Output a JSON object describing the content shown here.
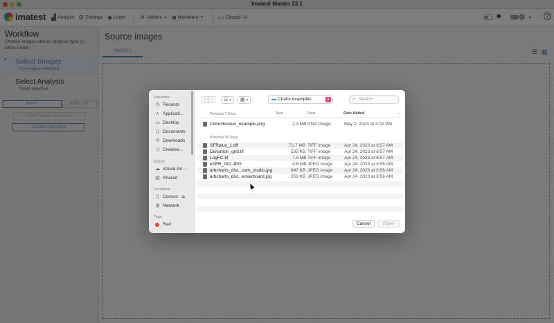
{
  "window": {
    "title": "Imatest Master 23.1"
  },
  "toolbar": {
    "logo": "imatest",
    "analyze": "Analyze",
    "settings": "Settings",
    "learn": "Learn",
    "utilities": "Utilities",
    "hardware": "Hardware",
    "classic_ui": "Classic UI"
  },
  "sidebar": {
    "title": "Workflow",
    "subtitle": "Choose images and an analysis type (in either order)",
    "step1": {
      "name": "Select Images",
      "sub": "No images selected"
    },
    "step2": {
      "name": "Select Analysis",
      "sub": "None selected"
    },
    "next": "NEXT",
    "analyze": "ANALYZE",
    "start_new": "START NEW ANALYSIS",
    "close_figures": "CLOSE FIGURES"
  },
  "main": {
    "title": "Source images",
    "tab_images": "IMAGES"
  },
  "dialog": {
    "sidebar": {
      "favorites_header": "Favorites",
      "favorites": [
        "Recents",
        "Applicati...",
        "Desktop",
        "Documents",
        "Downloads",
        "Creative..."
      ],
      "icloud_header": "iCloud",
      "icloud": [
        "iCloud Dri...",
        "Shared"
      ],
      "locations_header": "Locations",
      "locations": [
        "Consus",
        "Network"
      ],
      "tags_header": "Tags",
      "tags": [
        "Red"
      ]
    },
    "folder": "Charts examples",
    "search_placeholder": "Search",
    "columns": {
      "name": "",
      "size": "Size",
      "kind": "Kind",
      "date": "Date Added"
    },
    "group1": "Previous 7 Days",
    "group2": "Previous 30 Days",
    "files_recent": [
      {
        "name": "Colorchecker_example.png",
        "size": "2.3 MB",
        "kind": "PNG image",
        "date": "May 2, 2023 at 3:02 PM"
      }
    ],
    "files_30": [
      {
        "name": "SFRplus_1.tiff",
        "size": "72.7 MB",
        "kind": "TIFF image",
        "date": "Apr 24, 2023 at 8:57 AM"
      },
      {
        "name": "Distortion_grid.tif",
        "size": "535 KB",
        "kind": "TIFF image",
        "date": "Apr 24, 2023 at 8:57 AM"
      },
      {
        "name": "LogFC.tif",
        "size": "7.5 MB",
        "kind": "TIFF image",
        "date": "Apr 24, 2023 at 8:57 AM"
      },
      {
        "name": "eSFR_ISO.JPG",
        "size": "4.6 MB",
        "kind": "JPEG image",
        "date": "Apr 24, 2023 at 8:56 AM"
      },
      {
        "name": "arbcharts_dist...cam_studio.jpg",
        "size": "847 KB",
        "kind": "JPEG image",
        "date": "Apr 24, 2023 at 8:56 AM"
      },
      {
        "name": "arbcharts_dist...eckerboard.jpg",
        "size": "259 KB",
        "kind": "JPEG image",
        "date": "Apr 24, 2023 at 8:56 AM"
      }
    ],
    "cancel": "Cancel",
    "open": "Open"
  },
  "colors": {
    "accent": "#5f86b8",
    "folder_badge": "#d94f7a",
    "tag_red": "#e0443a"
  }
}
